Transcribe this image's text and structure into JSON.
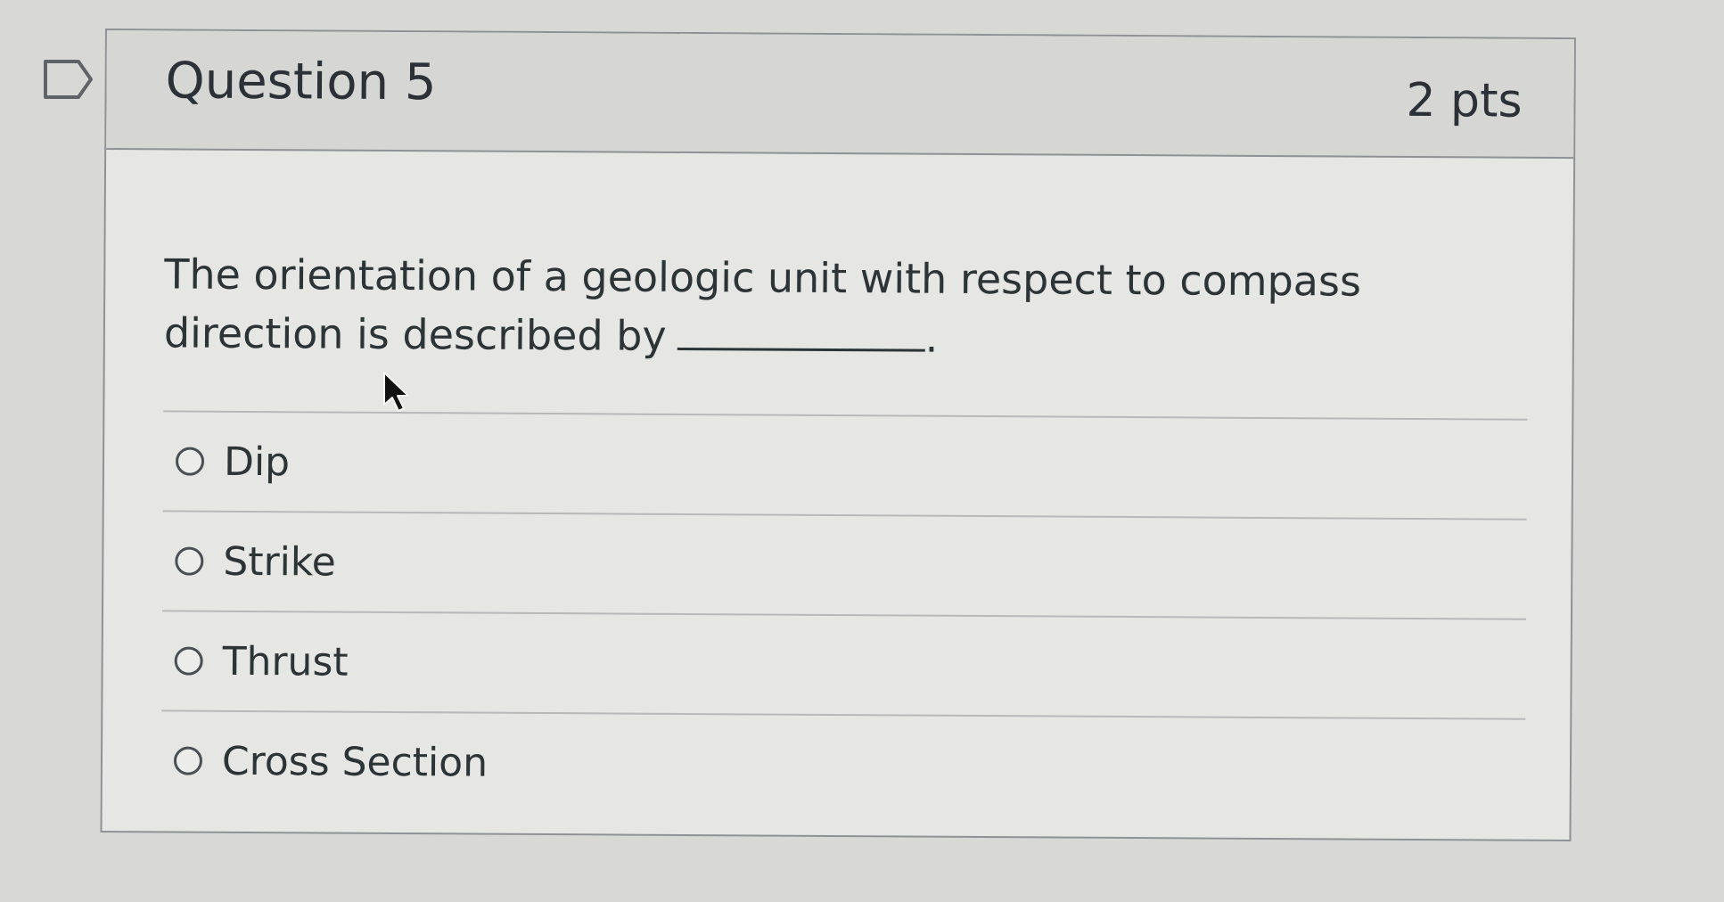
{
  "question": {
    "title": "Question 5",
    "points": "2 pts",
    "text": "The orientation of a geologic unit with respect to compass direction is described by",
    "blank_end": "."
  },
  "answers": [
    {
      "label": "Dip",
      "selected": false
    },
    {
      "label": "Strike",
      "selected": false
    },
    {
      "label": "Thrust",
      "selected": false
    },
    {
      "label": "Cross Section",
      "selected": false
    }
  ],
  "icons": {
    "flag": "flag-outline-icon",
    "cursor": "mouse-pointer-icon"
  },
  "colors": {
    "background": "#d8d8d6",
    "card": "#e6e6e4",
    "header": "#d6d6d4",
    "border": "#8f9294",
    "text": "#2d3436"
  }
}
